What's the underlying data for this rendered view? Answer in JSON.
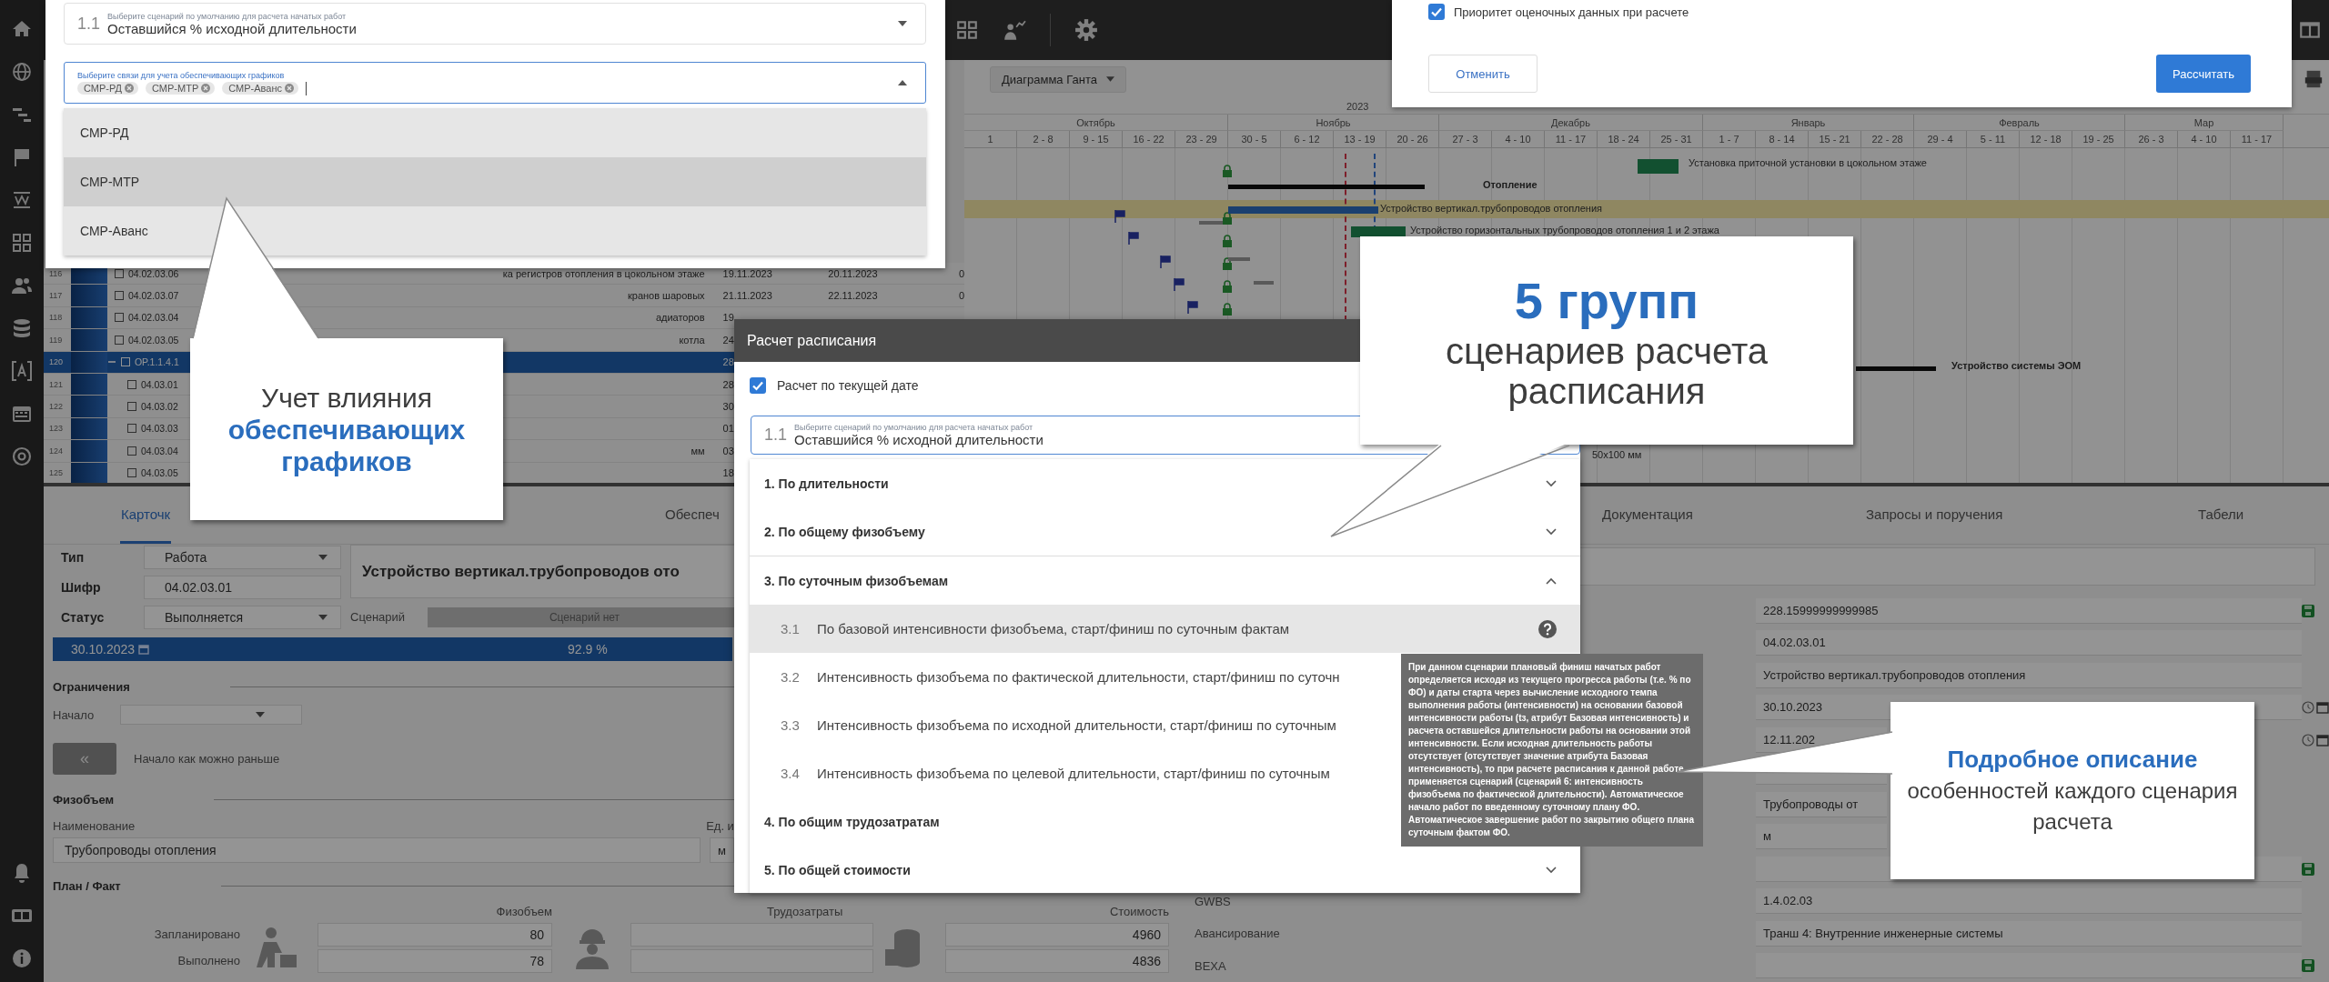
{
  "selector_panel": {
    "scenario_field": {
      "label": "Выберите сценарий по умолчанию для расчета начатых работ",
      "prefix": "1.1",
      "value": "Оставшийся % исходной длительности"
    },
    "links_field": {
      "label": "Выберите связи для учета обеспечивающих графиков",
      "chips": [
        "СМР-РД",
        "СМР-МТР",
        "СМР-Аванс"
      ],
      "expanded": true
    },
    "options": [
      {
        "label": "СМР-РД",
        "selected": false
      },
      {
        "label": "СМР-МТР",
        "selected": true
      },
      {
        "label": "СМР-Аванс",
        "selected": false
      }
    ]
  },
  "settings_dialog": {
    "priority": {
      "label": "Приоритет оценочных данных при расчете",
      "checked": true
    },
    "cancel_button": "Отменить",
    "calculate_button": "Рассчитать"
  },
  "gantt": {
    "view_button": "Диаграмма Ганта",
    "year": "2023",
    "months": [
      {
        "label": "Октябрь",
        "weeks": [
          "1",
          "2 - 8",
          "9 - 15",
          "16 - 22",
          "23 - 29"
        ]
      },
      {
        "label": "Ноябрь",
        "weeks": [
          "30 - 5",
          "6 - 12",
          "13 - 19",
          "20 - 26"
        ]
      },
      {
        "label": "Декабрь",
        "weeks": [
          "27 - 3",
          "4 - 10",
          "11 - 17",
          "18 - 24",
          "25 - 31"
        ]
      },
      {
        "label": "Январь",
        "weeks": [
          "1 - 7",
          "8 - 14",
          "15 - 21",
          "22 - 28"
        ]
      },
      {
        "label": "Февраль",
        "weeks": [
          "29 - 4",
          "5 - 11",
          "12 - 18",
          "19 - 25"
        ]
      },
      {
        "label": "Мар",
        "weeks": [
          "26 - 3",
          "4 - 10",
          "11 - 17"
        ]
      }
    ],
    "tasks": [
      {
        "label": "Установка приточной установки в цокольном этаже",
        "kind": "task",
        "selected": false
      },
      {
        "label": "Отопление",
        "kind": "summary",
        "selected": false
      },
      {
        "label": "Устройство вертикал.трубопроводов отопления",
        "kind": "progress",
        "selected": true
      },
      {
        "label": "Устройство горизонтальных трубопроводов отопления 1 и 2 этажа",
        "kind": "task",
        "selected": false
      },
      {
        "label": "Устройство системы ЭОМ",
        "kind": "summary",
        "selected": false
      },
      {
        "label": "50х100 мм",
        "kind": "label",
        "selected": false
      }
    ]
  },
  "table": {
    "rows": [
      {
        "num": "116",
        "code": "04.02.03.06",
        "name": "ка регистров отопления в цокольном этаже",
        "start": "19.11.2023",
        "finish": "20.11.2023",
        "value": "0",
        "selected": false
      },
      {
        "num": "117",
        "code": "04.02.03.07",
        "name": "кранов шаровых",
        "start": "21.11.2023",
        "finish": "22.11.2023",
        "value": "0",
        "selected": false
      },
      {
        "num": "118",
        "code": "04.02.03.04",
        "name": "адиаторов",
        "start": "19",
        "selected": false
      },
      {
        "num": "119",
        "code": "04.02.03.05",
        "name": "котла",
        "start": "24",
        "selected": false
      },
      {
        "num": "120",
        "code": "OP.1.1.4.1",
        "start": "28",
        "selected": true,
        "expanded": true,
        "children": [
          {
            "num": "121",
            "code": "04.03.01",
            "start": "28",
            "selected": false
          },
          {
            "num": "122",
            "code": "04.03.02",
            "start": "30",
            "selected": false
          },
          {
            "num": "123",
            "code": "04.03.03",
            "start": "01",
            "selected": false
          },
          {
            "num": "124",
            "code": "04.03.04",
            "name": "мм",
            "start": "03",
            "selected": false
          },
          {
            "num": "125",
            "code": "04.03.05",
            "start": "18",
            "selected": false
          }
        ]
      }
    ]
  },
  "bottom_tabs": [
    {
      "label": "Карточк",
      "selected": true
    },
    {
      "label": "Обеспеч",
      "selected": false
    },
    {
      "label": "Документация",
      "selected": false
    },
    {
      "label": "Запросы и поручения",
      "selected": false
    },
    {
      "label": "Табели",
      "selected": false
    }
  ],
  "card": {
    "type_label": "Тип",
    "type_value": "Работа",
    "code_label": "Шифр",
    "code_value": "04.02.03.01",
    "status_label": "Статус",
    "status_value": "Выполняется",
    "title": "Устройство вертикал.трубопроводов ото",
    "scenario_label": "Сценарий",
    "scenario_value": "Сценарий нет",
    "date": "30.10.2023",
    "percent": "92.9 %"
  },
  "constraints": {
    "heading": "Ограничения",
    "start_label": "Начало",
    "asap_button": "«",
    "asap_text": "Начало как можно раньше"
  },
  "volume": {
    "heading": "Физобъем",
    "name_label": "Наименование",
    "unit_label": "Ед. и",
    "name_value": "Трубопроводы отопления",
    "unit_value": "м"
  },
  "plan_fact": {
    "heading": "План / Факт",
    "volume_col": "Физобъем",
    "labor_col": "Трудозатраты",
    "cost_col": "Стоимость",
    "rows": [
      {
        "label": "Запланировано",
        "volume": "80",
        "cost": "4960"
      },
      {
        "label": "Выполнено",
        "volume": "78",
        "cost": "4836"
      }
    ]
  },
  "properties": [
    {
      "value": "228.15999999999985",
      "kind": "save"
    },
    {
      "value": "04.02.03.01",
      "kind": "plain"
    },
    {
      "value": "Устройство вертикал.трубопроводов отопления",
      "kind": "plain"
    },
    {
      "value": "30.10.2023",
      "kind": "date"
    },
    {
      "value": "12.11.202",
      "kind": "date"
    },
    {
      "kind": "plain"
    },
    {
      "value": "Трубопроводы от",
      "kind": "plain"
    },
    {
      "value": "м",
      "kind": "plain"
    },
    {
      "kind": "save"
    },
    {
      "label": "GWBS",
      "value": "1.4.02.03",
      "kind": "plain"
    },
    {
      "label": "Авансирование",
      "value": "Транш 4: Внутренние инженерные системы",
      "kind": "plain"
    },
    {
      "label": "ВЕХА",
      "kind": "save"
    }
  ],
  "schedule_dialog": {
    "title": "Расчет расписания",
    "current_date": {
      "label": "Расчет по текущей дате",
      "checked": true
    },
    "scenario_field": {
      "label": "Выберите сценарий по умолчанию для расчета начатых работ",
      "prefix": "1.1",
      "value": "Оставшийся % исходной длительности"
    },
    "groups": [
      {
        "title": "1. По длительности",
        "expanded": false
      },
      {
        "title": "2. По общему физобъему",
        "expanded": false
      },
      {
        "title": "3. По суточным физобъемам",
        "expanded": true,
        "items": [
          {
            "number": "3.1",
            "label": "По базовой интенсивности физобъема, старт/финиш по суточным фактам",
            "selected": true
          },
          {
            "number": "3.2",
            "label": "Интенсивность физобъема по фактической длительности, старт/финиш по суточн",
            "selected": false
          },
          {
            "number": "3.3",
            "label": "Интенсивность физобъема по исходной длительности, старт/финиш по суточным",
            "selected": false
          },
          {
            "number": "3.4",
            "label": "Интенсивность физобъема по целевой длительности, старт/финиш по суточным",
            "selected": false
          }
        ]
      },
      {
        "title": "4. По общим трудозатратам",
        "expanded": false
      },
      {
        "title": "5. По общей стоимости",
        "expanded": false
      }
    ]
  },
  "tooltip": "При данном сценарии плановый финиш начатых работ определяется исходя из текущего прогресса работы (т.е. % по ФО) и даты старта через вычисление исходного темпа выполнения работы (интенсивности) на основании базовой интенсивности работы (tз, атрибут Базовая интенсивность) и расчета оставшейся длительности работы на основании этой интенсивности. Если исходная длительность работы отсутствует (отсутствует значение атрибута Базовая интенсивность), то при расчете расписания к данной работе применяется сценарий (сценарий 6: интенсивность физобъема по фактической длительности). Автоматическое начало работ по введенному суточному плану ФО. Автоматическое завершение работ по закрытию общего плана суточным фактом ФО.",
  "callouts": {
    "links": "Учет влияния **обеспечивающих графиков**",
    "groups": "**5 групп** сценариев расчета расписания",
    "details": "**Подробное описание** особенностей каждого сценария расчета"
  }
}
